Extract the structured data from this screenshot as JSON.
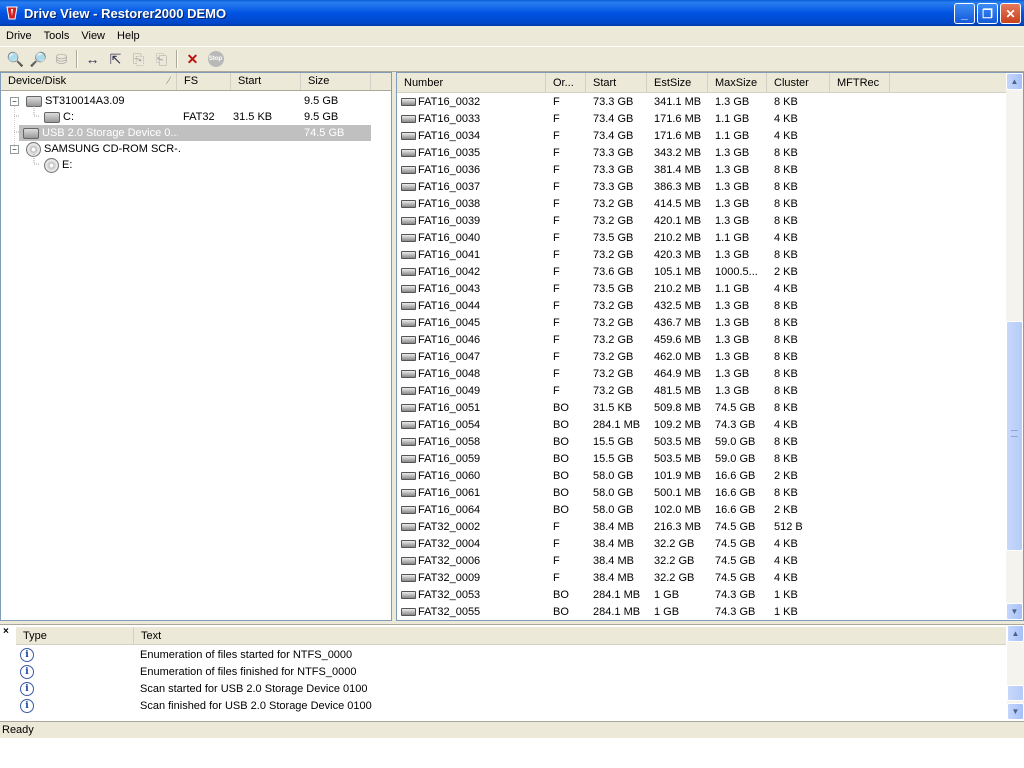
{
  "window": {
    "title": "Drive View - Restorer2000 DEMO"
  },
  "menu": [
    "Drive",
    "Tools",
    "View",
    "Help"
  ],
  "left_panel": {
    "columns": [
      "Device/Disk",
      "FS",
      "Start",
      "Size"
    ],
    "tree": [
      {
        "label": "ST310014A3.09",
        "fs": "",
        "start": "",
        "size": "9.5 GB",
        "type": "disk",
        "expander": "−",
        "selected": false
      },
      {
        "label": "C:",
        "fs": "FAT32",
        "start": "31.5 KB",
        "size": "9.5 GB",
        "type": "partition",
        "expander": "",
        "selected": false
      },
      {
        "label": "USB 2.0 Storage Device 0...",
        "fs": "",
        "start": "",
        "size": "74.5 GB",
        "type": "disk",
        "expander": "",
        "selected": true
      },
      {
        "label": "SAMSUNG CD-ROM SCR-...",
        "fs": "",
        "start": "",
        "size": "",
        "type": "cdrom",
        "expander": "−",
        "selected": false
      },
      {
        "label": "E:",
        "fs": "",
        "start": "",
        "size": "",
        "type": "cdpartition",
        "expander": "",
        "selected": false
      }
    ]
  },
  "right_panel": {
    "columns": [
      "Number",
      "Or...",
      "Start",
      "EstSize",
      "MaxSize",
      "Cluster",
      "MFTRec"
    ],
    "rows": [
      [
        "FAT16_0032",
        "F",
        "73.3 GB",
        "341.1 MB",
        "1.3 GB",
        "8 KB",
        ""
      ],
      [
        "FAT16_0033",
        "F",
        "73.4 GB",
        "171.6 MB",
        "1.1 GB",
        "4 KB",
        ""
      ],
      [
        "FAT16_0034",
        "F",
        "73.4 GB",
        "171.6 MB",
        "1.1 GB",
        "4 KB",
        ""
      ],
      [
        "FAT16_0035",
        "F",
        "73.3 GB",
        "343.2 MB",
        "1.3 GB",
        "8 KB",
        ""
      ],
      [
        "FAT16_0036",
        "F",
        "73.3 GB",
        "381.4 MB",
        "1.3 GB",
        "8 KB",
        ""
      ],
      [
        "FAT16_0037",
        "F",
        "73.3 GB",
        "386.3 MB",
        "1.3 GB",
        "8 KB",
        ""
      ],
      [
        "FAT16_0038",
        "F",
        "73.2 GB",
        "414.5 MB",
        "1.3 GB",
        "8 KB",
        ""
      ],
      [
        "FAT16_0039",
        "F",
        "73.2 GB",
        "420.1 MB",
        "1.3 GB",
        "8 KB",
        ""
      ],
      [
        "FAT16_0040",
        "F",
        "73.5 GB",
        "210.2 MB",
        "1.1 GB",
        "4 KB",
        ""
      ],
      [
        "FAT16_0041",
        "F",
        "73.2 GB",
        "420.3 MB",
        "1.3 GB",
        "8 KB",
        ""
      ],
      [
        "FAT16_0042",
        "F",
        "73.6 GB",
        "105.1 MB",
        "1000.5...",
        "2 KB",
        ""
      ],
      [
        "FAT16_0043",
        "F",
        "73.5 GB",
        "210.2 MB",
        "1.1 GB",
        "4 KB",
        ""
      ],
      [
        "FAT16_0044",
        "F",
        "73.2 GB",
        "432.5 MB",
        "1.3 GB",
        "8 KB",
        ""
      ],
      [
        "FAT16_0045",
        "F",
        "73.2 GB",
        "436.7 MB",
        "1.3 GB",
        "8 KB",
        ""
      ],
      [
        "FAT16_0046",
        "F",
        "73.2 GB",
        "459.6 MB",
        "1.3 GB",
        "8 KB",
        ""
      ],
      [
        "FAT16_0047",
        "F",
        "73.2 GB",
        "462.0 MB",
        "1.3 GB",
        "8 KB",
        ""
      ],
      [
        "FAT16_0048",
        "F",
        "73.2 GB",
        "464.9 MB",
        "1.3 GB",
        "8 KB",
        ""
      ],
      [
        "FAT16_0049",
        "F",
        "73.2 GB",
        "481.5 MB",
        "1.3 GB",
        "8 KB",
        ""
      ],
      [
        "FAT16_0051",
        "BO",
        "31.5 KB",
        "509.8 MB",
        "74.5 GB",
        "8 KB",
        ""
      ],
      [
        "FAT16_0054",
        "BO",
        "284.1 MB",
        "109.2 MB",
        "74.3 GB",
        "4 KB",
        ""
      ],
      [
        "FAT16_0058",
        "BO",
        "15.5 GB",
        "503.5 MB",
        "59.0 GB",
        "8 KB",
        ""
      ],
      [
        "FAT16_0059",
        "BO",
        "15.5 GB",
        "503.5 MB",
        "59.0 GB",
        "8 KB",
        ""
      ],
      [
        "FAT16_0060",
        "BO",
        "58.0 GB",
        "101.9 MB",
        "16.6 GB",
        "2 KB",
        ""
      ],
      [
        "FAT16_0061",
        "BO",
        "58.0 GB",
        "500.1 MB",
        "16.6 GB",
        "8 KB",
        ""
      ],
      [
        "FAT16_0064",
        "BO",
        "58.0 GB",
        "102.0 MB",
        "16.6 GB",
        "2 KB",
        ""
      ],
      [
        "FAT32_0002",
        "F",
        "38.4 MB",
        "216.3 MB",
        "74.5 GB",
        "512 B",
        ""
      ],
      [
        "FAT32_0004",
        "F",
        "38.4 MB",
        "32.2 GB",
        "74.5 GB",
        "4 KB",
        ""
      ],
      [
        "FAT32_0006",
        "F",
        "38.4 MB",
        "32.2 GB",
        "74.5 GB",
        "4 KB",
        ""
      ],
      [
        "FAT32_0009",
        "F",
        "38.4 MB",
        "32.2 GB",
        "74.5 GB",
        "4 KB",
        ""
      ],
      [
        "FAT32_0053",
        "BO",
        "284.1 MB",
        "1 GB",
        "74.3 GB",
        "1 KB",
        ""
      ],
      [
        "FAT32_0055",
        "BO",
        "284.1 MB",
        "1 GB",
        "74.3 GB",
        "1 KB",
        ""
      ]
    ]
  },
  "log": {
    "close_glyph": "×",
    "columns": [
      "Type",
      "Text"
    ],
    "rows": [
      {
        "icon": "info-icon",
        "glyph": "i",
        "text": "Enumeration of files started for NTFS_0000"
      },
      {
        "icon": "info-icon",
        "glyph": "i",
        "text": "Enumeration of files finished for NTFS_0000"
      },
      {
        "icon": "info-icon",
        "glyph": "i",
        "text": "Scan started for USB 2.0 Storage Device 0100"
      },
      {
        "icon": "info-icon",
        "glyph": "i",
        "text": "Scan finished for USB 2.0 Storage Device 0100"
      }
    ]
  },
  "status": {
    "text": "Ready"
  },
  "toolbar": {
    "buttons": [
      {
        "name": "scan-icon",
        "glyph": "🔍",
        "enabled": true
      },
      {
        "name": "search-icon",
        "glyph": "🔎",
        "enabled": true
      },
      {
        "name": "drive-options-icon",
        "glyph": "⛁",
        "enabled": false
      },
      {
        "name": "resize-icon",
        "glyph": "↔",
        "enabled": true
      },
      {
        "name": "open-icon",
        "glyph": "⇱",
        "enabled": true
      },
      {
        "name": "recover-icon",
        "glyph": "⎘",
        "enabled": false
      },
      {
        "name": "recover-all-icon",
        "glyph": "⎗",
        "enabled": false
      },
      {
        "name": "delete-icon",
        "glyph": "✕",
        "enabled": true
      },
      {
        "name": "stop-icon",
        "glyph": "Stop",
        "enabled": false
      }
    ]
  },
  "colors": {
    "titlebar": "#0054e3",
    "selection": "#c0c0c0",
    "close_button": "#c8401c"
  }
}
